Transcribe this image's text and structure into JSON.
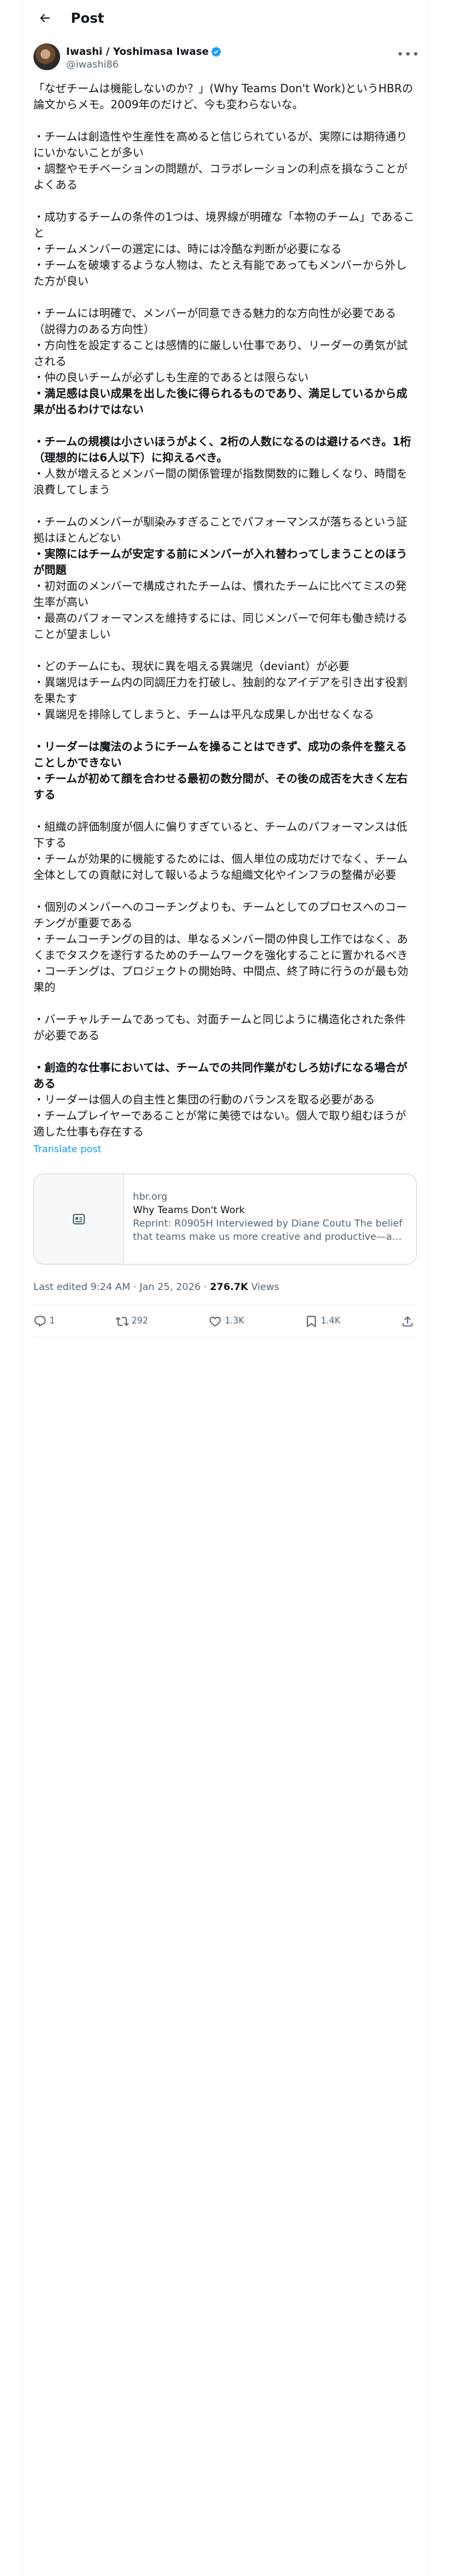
{
  "header": {
    "title": "Post"
  },
  "author": {
    "name": "Iwashi / Yoshimasa Iwase",
    "handle": "@iwashi86"
  },
  "tweet": {
    "lines": [
      {
        "text": "「なぜチームは機能しないのか？」(Why Teams Don't Work)というHBRの論文からメモ。2009年のだけど、今も変わらないな。",
        "bold": false
      },
      {
        "text": "",
        "bold": false
      },
      {
        "text": "・チームは創造性や生産性を高めると信じられているが、実際には期待通りにいかないことが多い",
        "bold": false
      },
      {
        "text": "・調整やモチベーションの問題が、コラボレーションの利点を損なうことがよくある",
        "bold": false
      },
      {
        "text": "",
        "bold": false
      },
      {
        "text": "・成功するチームの条件の1つは、境界線が明確な「本物のチーム」であること",
        "bold": false
      },
      {
        "text": "・チームメンバーの選定には、時には冷酷な判断が必要になる",
        "bold": false
      },
      {
        "text": "・チームを破壊するような人物は、たとえ有能であってもメンバーから外した方が良い",
        "bold": false
      },
      {
        "text": "",
        "bold": false
      },
      {
        "text": "・チームには明確で、メンバーが同意できる魅力的な方向性が必要である（説得力のある方向性）",
        "bold": false
      },
      {
        "text": "・方向性を設定することは感情的に厳しい仕事であり、リーダーの勇気が試される",
        "bold": false
      },
      {
        "text": "・仲の良いチームが必ずしも生産的であるとは限らない",
        "bold": false
      },
      {
        "text": "・満足感は良い成果を出した後に得られるものであり、満足しているから成果が出るわけではない",
        "bold": true
      },
      {
        "text": "",
        "bold": false
      },
      {
        "text": "・チームの規模は小さいほうがよく、2桁の人数になるのは避けるべき。1桁（理想的には6人以下）に抑えるべき。",
        "bold": true
      },
      {
        "text": "・人数が増えるとメンバー間の関係管理が指数関数的に難しくなり、時間を浪費してしまう",
        "bold": false
      },
      {
        "text": "",
        "bold": false
      },
      {
        "text": "・チームのメンバーが馴染みすぎることでパフォーマンスが落ちるという証拠はほとんどない",
        "bold": false
      },
      {
        "text": "・実際にはチームが安定する前にメンバーが入れ替わってしまうことのほうが問題",
        "bold": true
      },
      {
        "text": "・初対面のメンバーで構成されたチームは、慣れたチームに比べてミスの発生率が高い",
        "bold": false
      },
      {
        "text": "・最高のパフォーマンスを維持するには、同じメンバーで何年も働き続けることが望ましい",
        "bold": false
      },
      {
        "text": "",
        "bold": false
      },
      {
        "text": "・どのチームにも、現状に異を唱える異端児（deviant）が必要",
        "bold": false
      },
      {
        "text": "・異端児はチーム内の同調圧力を打破し、独創的なアイデアを引き出す役割を果たす",
        "bold": false
      },
      {
        "text": "・異端児を排除してしまうと、チームは平凡な成果しか出せなくなる",
        "bold": false
      },
      {
        "text": "",
        "bold": false
      },
      {
        "text": "・リーダーは魔法のようにチームを操ることはできず、成功の条件を整えることしかできない",
        "bold": true
      },
      {
        "text": "・チームが初めて顔を合わせる最初の数分間が、その後の成否を大きく左右する",
        "bold": true
      },
      {
        "text": "",
        "bold": false
      },
      {
        "text": "・組織の評価制度が個人に偏りすぎていると、チームのパフォーマンスは低下する",
        "bold": false
      },
      {
        "text": "・チームが効果的に機能するためには、個人単位の成功だけでなく、チーム全体としての貢献に対して報いるような組織文化やインフラの整備が必要",
        "bold": false
      },
      {
        "text": "",
        "bold": false
      },
      {
        "text": "・個別のメンバーへのコーチングよりも、チームとしてのプロセスへのコーチングが重要である",
        "bold": false
      },
      {
        "text": "・チームコーチングの目的は、単なるメンバー間の仲良し工作ではなく、あくまでタスクを遂行するためのチームワークを強化することに置かれるべき",
        "bold": false
      },
      {
        "text": "・コーチングは、プロジェクトの開始時、中間点、終了時に行うのが最も効果的",
        "bold": false
      },
      {
        "text": "",
        "bold": false
      },
      {
        "text": "・バーチャルチームであっても、対面チームと同じように構造化された条件が必要である",
        "bold": false
      },
      {
        "text": "",
        "bold": false
      },
      {
        "text": "・創造的な仕事においては、チームでの共同作業がむしろ妨げになる場合がある",
        "bold": true
      },
      {
        "text": "・リーダーは個人の自主性と集団の行動のバランスを取る必要がある",
        "bold": false
      },
      {
        "text": "・チームプレイヤーであることが常に美徳ではない。個人で取り組むほうが適した仕事も存在する",
        "bold": false
      }
    ],
    "translate_label": "Translate post"
  },
  "card": {
    "domain": "hbr.org",
    "title": "Why Teams Don't Work",
    "description": "Reprint: R0905H Interviewed by Diane Coutu The belief that teams make us more creative and productive—and ar..."
  },
  "meta": {
    "edited": "Last edited 9:24 AM · Jan 25, 2026 · ",
    "views_count": "276.7K",
    "views_label": " Views"
  },
  "actions": {
    "replies": "1",
    "reposts": "292",
    "likes": "1.3K",
    "bookmarks": "1.4K"
  },
  "colors": {
    "accent": "#1d9bf0",
    "text": "#0f1419",
    "secondary": "#536471",
    "border": "#eff3f4"
  }
}
